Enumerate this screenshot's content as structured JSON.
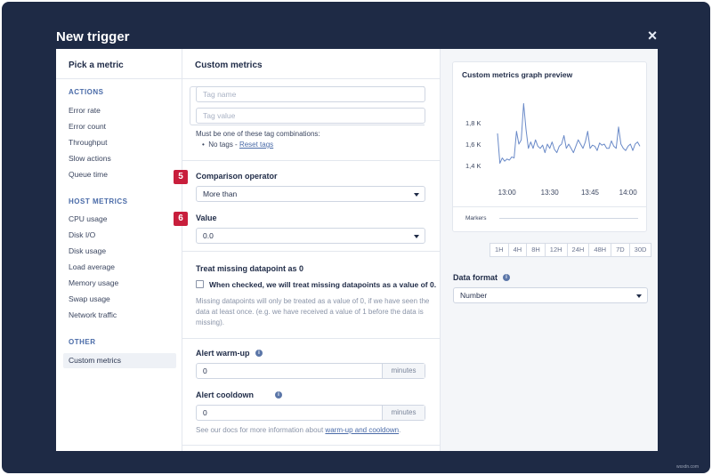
{
  "modal": {
    "title": "New trigger",
    "close_symbol": "×"
  },
  "left": {
    "heading": "Pick a metric",
    "sections": {
      "actions": {
        "label": "ACTIONS",
        "items": [
          "Error rate",
          "Error count",
          "Throughput",
          "Slow actions",
          "Queue time"
        ]
      },
      "host": {
        "label": "HOST METRICS",
        "items": [
          "CPU usage",
          "Disk I/O",
          "Disk usage",
          "Load average",
          "Memory usage",
          "Swap usage",
          "Network traffic"
        ]
      },
      "other": {
        "label": "OTHER",
        "items": [
          "Custom metrics"
        ]
      }
    }
  },
  "middle": {
    "heading": "Custom metrics",
    "tag_name_placeholder": "Tag name",
    "tag_value_placeholder": "Tag value",
    "combinations_text": "Must be one of these tag combinations:",
    "no_tags_text": "No tags - ",
    "reset_tags_link": "Reset tags",
    "comparison": {
      "step": "5",
      "label": "Comparison operator",
      "value": "More than"
    },
    "value": {
      "step": "6",
      "label": "Value",
      "value": "0.0"
    },
    "missing": {
      "heading": "Treat missing datapoint as 0",
      "checkbox_label": "When checked, we will treat missing datapoints as a value of 0.",
      "help_text": "Missing datapoints will only be treated as a value of 0, if we have seen the data at least once. (e.g. we have received a value of 1 before the data is missing)."
    },
    "warmup": {
      "label": "Alert warm-up",
      "value": "0",
      "unit": "minutes"
    },
    "cooldown": {
      "label": "Alert cooldown",
      "value": "0",
      "unit": "minutes"
    },
    "docs_text": "See our docs for more information about ",
    "docs_link": "warm-up and cooldown",
    "docs_end": "."
  },
  "right": {
    "graph_title": "Custom metrics graph preview",
    "markers_label": "Markers",
    "ranges": [
      "1H",
      "4H",
      "8H",
      "12H",
      "24H",
      "48H",
      "7D",
      "30D"
    ],
    "data_format_label": "Data format",
    "data_format_value": "Number",
    "line_color": "#6a8ac8"
  },
  "chart_data": {
    "type": "line",
    "title": "Custom metrics graph preview",
    "xlabel": "",
    "ylabel": "",
    "x_tick_labels": [
      "13:00",
      "13:30",
      "13:45",
      "14:00"
    ],
    "y_tick_labels": [
      "1,8 K",
      "1,6 K",
      "1,4 K"
    ],
    "ylim": [
      1300,
      2050
    ],
    "y_ticks": [
      1800,
      1600,
      1400
    ],
    "x_range": [
      0,
      60
    ],
    "x_ticks": [
      4,
      22,
      39,
      55
    ],
    "series": [
      {
        "values": [
          1700,
          1420,
          1470,
          1440,
          1460,
          1450,
          1480,
          1470,
          1720,
          1600,
          1640,
          1980,
          1740,
          1560,
          1620,
          1560,
          1640,
          1580,
          1560,
          1590,
          1520,
          1600,
          1560,
          1620,
          1550,
          1520,
          1580,
          1600,
          1680,
          1560,
          1600,
          1560,
          1520,
          1580,
          1640,
          1600,
          1560,
          1620,
          1720,
          1560,
          1590,
          1580,
          1540,
          1610,
          1590,
          1600,
          1560,
          1560,
          1630,
          1580,
          1560,
          1760,
          1600,
          1560,
          1540,
          1580,
          1600,
          1540,
          1600,
          1620,
          1580
        ]
      }
    ]
  },
  "watermark": "wsxdn.com"
}
